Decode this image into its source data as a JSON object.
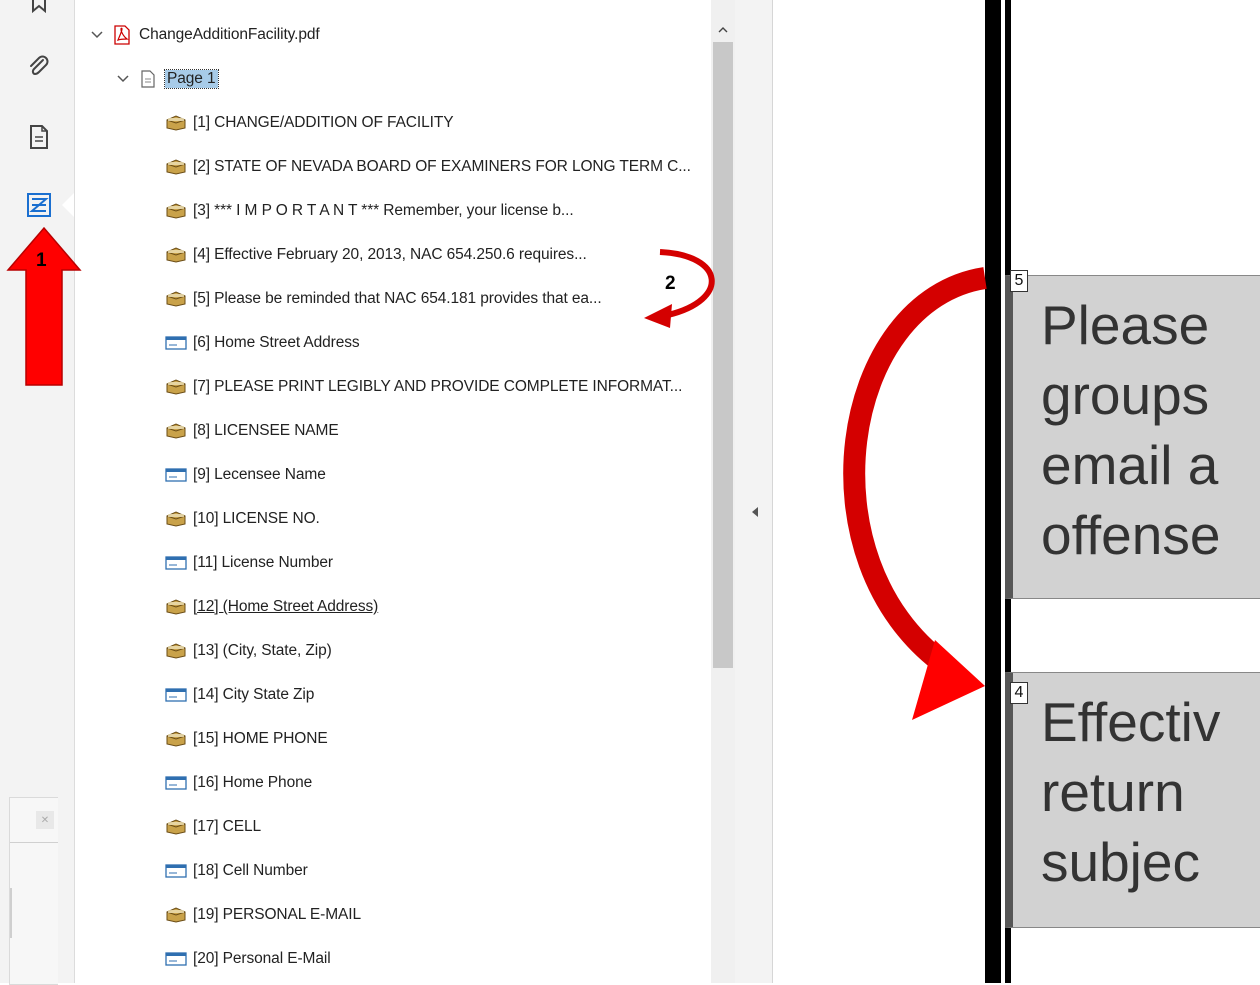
{
  "tree": {
    "file": {
      "name": "ChangeAdditionFacility.pdf",
      "icon": "pdf-icon"
    },
    "page": {
      "label": "Page 1",
      "icon": "page-icon"
    },
    "items": [
      {
        "label": "[1]  CHANGE/ADDITION OF FACILITY",
        "icon": "tag-box-icon"
      },
      {
        "label": "[2]  STATE OF NEVADA BOARD OF EXAMINERS FOR LONG TERM C...",
        "icon": "tag-box-icon"
      },
      {
        "label": "[3]  *** I M P O R T A N T *** Remember, your license b...",
        "icon": "tag-box-icon"
      },
      {
        "label": "[4]  Effective February 20, 2013, NAC 654.250.6 requires...",
        "icon": "tag-box-icon"
      },
      {
        "label": "[5]  Please be reminded that NAC 654.181 provides that ea...",
        "icon": "tag-box-icon"
      },
      {
        "label": "[6]  Home Street Address",
        "icon": "form-field-icon"
      },
      {
        "label": "[7]  PLEASE PRINT LEGIBLY AND PROVIDE COMPLETE INFORMAT...",
        "icon": "tag-box-icon"
      },
      {
        "label": "[8]  LICENSEE NAME",
        "icon": "tag-box-icon"
      },
      {
        "label": "[9]  Lecensee Name",
        "icon": "form-field-icon"
      },
      {
        "label": "[10]  LICENSE NO.",
        "icon": "tag-box-icon"
      },
      {
        "label": "[11]  License Number",
        "icon": "form-field-icon"
      },
      {
        "label": "[12]  (Home Street Address)",
        "icon": "tag-box-icon"
      },
      {
        "label": "[13]  (City, State, Zip)",
        "icon": "tag-box-icon"
      },
      {
        "label": "[14]  City State Zip",
        "icon": "form-field-icon"
      },
      {
        "label": "[15]  HOME PHONE",
        "icon": "tag-box-icon"
      },
      {
        "label": "[16]  Home Phone",
        "icon": "form-field-icon"
      },
      {
        "label": "[17]  CELL",
        "icon": "tag-box-icon"
      },
      {
        "label": "[18]  Cell Number",
        "icon": "form-field-icon"
      },
      {
        "label": "[19]  PERSONAL E-MAIL",
        "icon": "tag-box-icon"
      },
      {
        "label": "[20]  Personal E-Mail",
        "icon": "form-field-icon"
      }
    ]
  },
  "document": {
    "tag5": {
      "number": "5",
      "lines": [
        "Please",
        "groups",
        "email a",
        "offense"
      ]
    },
    "tag4": {
      "number": "4",
      "lines": [
        "Effectiv",
        "return",
        "subjec"
      ]
    }
  },
  "annotations": {
    "label1": "1",
    "label2": "2"
  },
  "colors": {
    "selection": "#a7cbe8",
    "arrow": "#e00000",
    "tag_box": "#d2d2d2"
  }
}
